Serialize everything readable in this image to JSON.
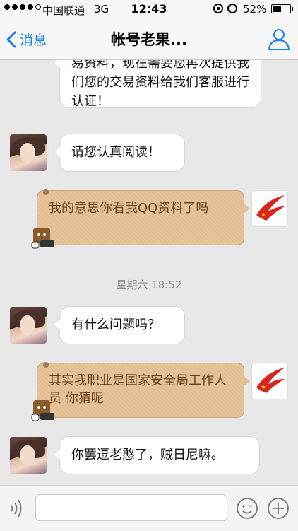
{
  "status_bar": {
    "carrier": "中国联通",
    "network": "3G",
    "time": "12:43",
    "battery": "52%",
    "battery_level": 0.52,
    "signal_bars": 4
  },
  "nav": {
    "back_label": "消息",
    "title": "帐号老果..."
  },
  "messages": [
    {
      "side": "left",
      "text": "易资料，现在需要您再次提供我们您的交易资料给我们客服进行认证！"
    },
    {
      "side": "left",
      "text": "请您认真阅读！"
    },
    {
      "side": "right",
      "text": "我的意思你看我QQ资料了吗"
    },
    {
      "type": "timestamp",
      "text": "星期六 18:52"
    },
    {
      "side": "left",
      "text": "有什么问题吗？"
    },
    {
      "side": "right",
      "text": "其实我职业是国家安全局工作人员 你猜呢"
    },
    {
      "side": "left",
      "text": "你罢逗老憨了，贼日尼嘛。"
    }
  ],
  "colors": {
    "accent": "#157efb",
    "bubble_beige": "#e5c095",
    "bubble_text_beige": "#6b3e1a",
    "background": "#e8e8e8"
  }
}
